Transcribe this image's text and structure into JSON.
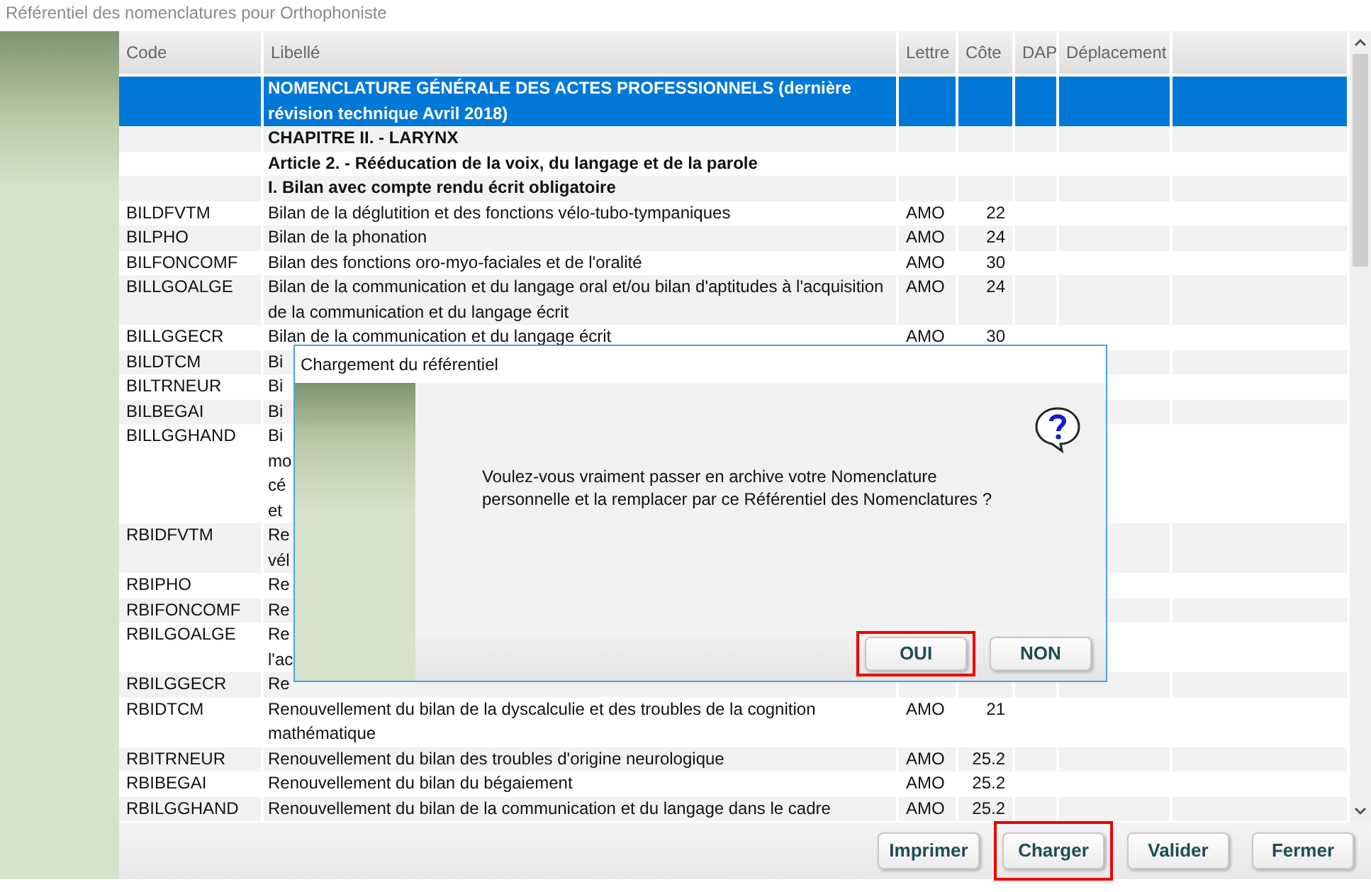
{
  "window": {
    "title": "Référentiel des nomenclatures pour Orthophoniste"
  },
  "table": {
    "columns": [
      "Code",
      "Libellé",
      "Lettre",
      "Côte",
      "DAP",
      "Déplacement"
    ],
    "rows": [
      {
        "kind": "section",
        "selected": true,
        "label": "NOMENCLATURE GÉNÉRALE DES ACTES PROFESSIONNELS  (dernière révision technique Avril 2018)"
      },
      {
        "kind": "section",
        "selected": false,
        "label": "CHAPITRE II. - LARYNX"
      },
      {
        "kind": "section",
        "selected": false,
        "label": "Article 2. - Rééducation de la voix, du langage et de la parole"
      },
      {
        "kind": "section",
        "selected": false,
        "label": "I. Bilan avec compte rendu écrit obligatoire"
      },
      {
        "kind": "act",
        "selected": false,
        "code": "BILDFVTM",
        "label": "Bilan de la déglutition et des fonctions vélo-tubo-tympaniques",
        "letter": "AMO",
        "rate": "22"
      },
      {
        "kind": "act",
        "selected": false,
        "code": "BILPHO",
        "label": "Bilan de la phonation",
        "letter": "AMO",
        "rate": "24"
      },
      {
        "kind": "act",
        "selected": false,
        "code": "BILFONCOMF",
        "label": "Bilan des fonctions oro-myo-faciales et de l'oralité",
        "letter": "AMO",
        "rate": "30"
      },
      {
        "kind": "act",
        "selected": false,
        "code": "BILLGOALGE",
        "label": "Bilan de la communication et du langage oral et/ou bilan d'aptitudes à l'acquisition de la communication et du langage écrit",
        "letter": "AMO",
        "rate": "24"
      },
      {
        "kind": "act",
        "selected": false,
        "code": "BILLGGECR",
        "label": "Bilan de la communication et du langage écrit",
        "letter": "AMO",
        "rate": "30"
      },
      {
        "kind": "act",
        "selected": false,
        "code": "BILDTCM",
        "label": "Bi"
      },
      {
        "kind": "act",
        "selected": false,
        "code": "BILTRNEUR",
        "label": "Bi"
      },
      {
        "kind": "act",
        "selected": false,
        "code": "BILBEGAI",
        "label": "Bi"
      },
      {
        "kind": "act",
        "selected": false,
        "code": "BILLGGHAND",
        "label": "Bi\nmo\ncé\net"
      },
      {
        "kind": "act",
        "selected": false,
        "code": "RBIDFVTM",
        "label": "Re\nvél"
      },
      {
        "kind": "act",
        "selected": false,
        "code": "RBIPHO",
        "label": "Re"
      },
      {
        "kind": "act",
        "selected": false,
        "code": "RBIFONCOMF",
        "label": "Re"
      },
      {
        "kind": "act",
        "selected": false,
        "code": "RBILGOALGE",
        "label": "Re\nl'ac"
      },
      {
        "kind": "act",
        "selected": false,
        "code": "RBILGGECR",
        "label": "Re"
      },
      {
        "kind": "act",
        "selected": false,
        "code": "RBIDTCM",
        "label": "Renouvellement du bilan de la dyscalculie et des troubles de la cognition mathématique",
        "letter": "AMO",
        "rate": "21"
      },
      {
        "kind": "act",
        "selected": false,
        "code": "RBITRNEUR",
        "label": "Renouvellement du bilan des troubles d'origine neurologique",
        "letter": "AMO",
        "rate": "25.2"
      },
      {
        "kind": "act",
        "selected": false,
        "code": "RBIBEGAI",
        "label": "Renouvellement du bilan du bégaiement",
        "letter": "AMO",
        "rate": "25.2"
      },
      {
        "kind": "act",
        "selected": false,
        "code": "RBILGGHAND",
        "label": "Renouvellement du bilan de la communication et du langage dans le cadre",
        "letter": "AMO",
        "rate": "25.2"
      }
    ]
  },
  "buttons": [
    {
      "label": "Imprimer",
      "highlighted": false
    },
    {
      "label": "Charger",
      "highlighted": true
    },
    {
      "label": "Valider",
      "highlighted": false
    },
    {
      "label": "Fermer",
      "highlighted": false
    }
  ],
  "dialog": {
    "title": "Chargement du référentiel",
    "message": "Voulez-vous vraiment passer en archive votre Nomenclature personnelle et la remplacer par ce Référentiel des Nomenclatures ?",
    "buttons": [
      {
        "label": "OUI",
        "highlighted": true
      },
      {
        "label": "NON",
        "highlighted": false
      }
    ]
  }
}
